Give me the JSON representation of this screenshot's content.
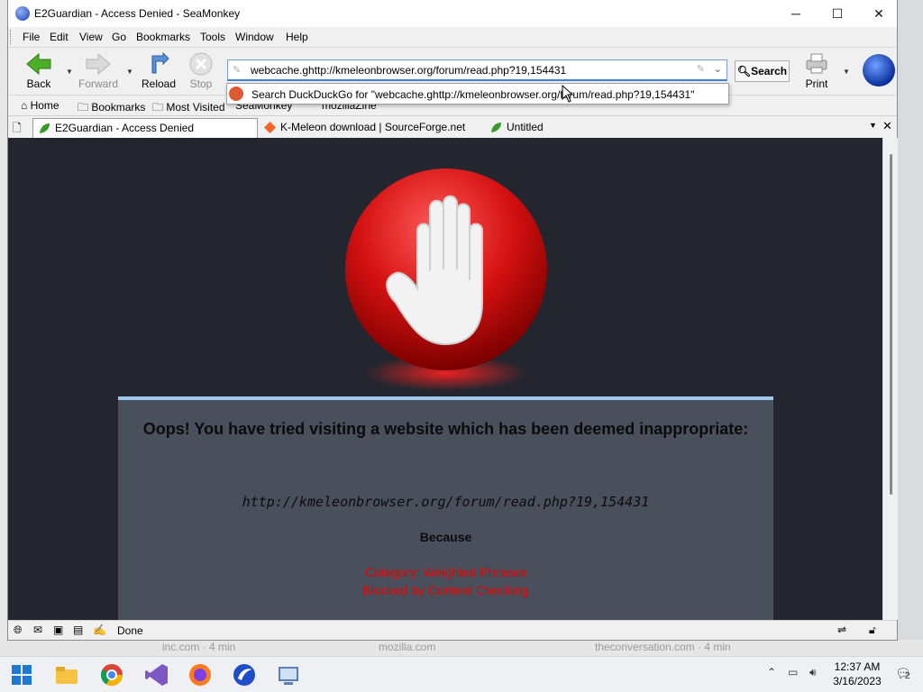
{
  "window": {
    "title": "E2Guardian - Access Denied - SeaMonkey",
    "controls": {
      "minimize": "─",
      "maximize": "☐",
      "close": "✕"
    }
  },
  "menu": [
    "File",
    "Edit",
    "View",
    "Go",
    "Bookmarks",
    "Tools",
    "Window",
    "Help"
  ],
  "nav": {
    "back": "Back",
    "forward": "Forward",
    "reload": "Reload",
    "stop": "Stop",
    "url": "webcache.ghttp://kmeleonbrowser.org/forum/read.php?19,154431",
    "search_button": "Search",
    "print": "Print"
  },
  "autocomplete": {
    "text": "Search DuckDuckGo for \"webcache.ghttp://kmeleonbrowser.org/forum/read.php?19,154431\""
  },
  "bookmarks_bar": [
    "Home",
    "Bookmarks",
    "Most Visited",
    "SeaMonkey",
    "mozillaZine"
  ],
  "tabs": [
    {
      "label": "E2Guardian - Access Denied",
      "active": true
    },
    {
      "label": "K-Meleon download | SourceForge.net",
      "active": false
    },
    {
      "label": "Untitled",
      "active": false
    }
  ],
  "page": {
    "heading": "Oops! You have tried visiting a website which has been deemed inappropriate:",
    "blocked_url": "http://kmeleonbrowser.org/forum/read.php?19,154431",
    "because": "Because",
    "reason1": "Category: Weighted Phrases",
    "reason2": "Blocked by Content Checking",
    "accent_color": "#9fc7ea",
    "reason_color": "#e80000"
  },
  "status": {
    "text": "Done"
  },
  "background_strip": [
    "inc.com · 4 min",
    "mozilla.com",
    "theconversation.com · 4 min"
  ],
  "taskbar": {
    "time": "12:37 AM",
    "date": "3/16/2023",
    "notification_count": "2",
    "apps": [
      "windows-start",
      "file-explorer",
      "chrome",
      "visual-studio",
      "firefox",
      "seamonkey",
      "network-app"
    ]
  }
}
